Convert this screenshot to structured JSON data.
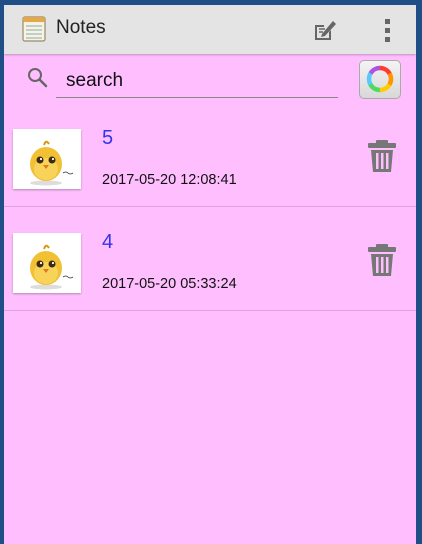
{
  "header": {
    "title": "Notes"
  },
  "search": {
    "value": "search",
    "placeholder": "search"
  },
  "notes": [
    {
      "title": "5",
      "date": "2017-05-20 12:08:41"
    },
    {
      "title": "4",
      "date": "2017-05-20 05:33:24"
    }
  ],
  "icons": {
    "app": "notepad-icon",
    "edit": "edit-note-icon",
    "overflow": "overflow-menu-icon",
    "search": "search-icon",
    "color": "color-wheel-icon",
    "delete": "trash-icon",
    "thumbnail": "chick-thumbnail-icon"
  },
  "colors": {
    "background": "#ffbfff",
    "action_bar": "#e4e4e4",
    "title_text": "#3333ee",
    "backdrop": "#1f4f86"
  }
}
